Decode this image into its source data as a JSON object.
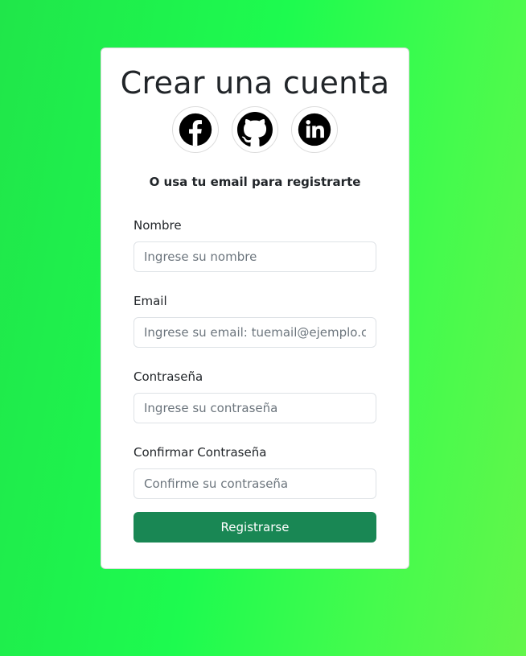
{
  "form": {
    "title": "Crear una cuenta",
    "subtitle": "O usa tu email para registrarte",
    "social_icons": [
      "facebook-icon",
      "github-icon",
      "linkedin-icon"
    ],
    "fields": [
      {
        "label": "Nombre",
        "placeholder": "Ingrese su nombre",
        "value": ""
      },
      {
        "label": "Email",
        "placeholder": "Ingrese su email: tuemail@ejemplo.com",
        "value": ""
      },
      {
        "label": "Contraseña",
        "placeholder": "Ingrese su contraseña",
        "value": ""
      },
      {
        "label": "Confirmar Contraseña",
        "placeholder": "Confirme su contraseña",
        "value": ""
      }
    ],
    "submit_label": "Registrarse"
  },
  "colors": {
    "background_gradient": [
      "#20e64a",
      "#1dfb4f",
      "#63f64a"
    ],
    "button": "#198754",
    "text": "#212529",
    "icon": "#000000"
  }
}
